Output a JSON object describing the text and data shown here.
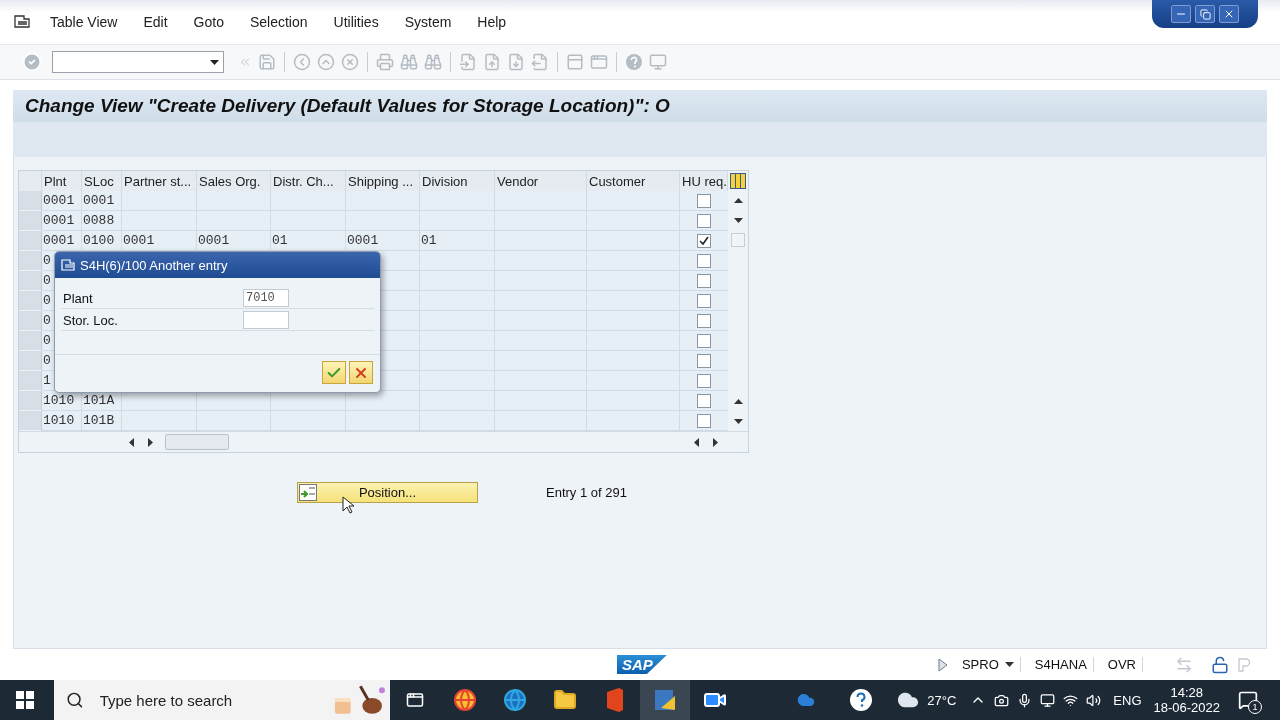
{
  "menu_bar": [
    "Table View",
    "Edit",
    "Goto",
    "Selection",
    "Utilities",
    "System",
    "Help"
  ],
  "title": "Change View \"Create Delivery (Default Values for Storage Location)\": O",
  "table": {
    "columns": [
      "Plnt",
      "SLoc",
      "Partner st...",
      "Sales Org.",
      "Distr. Ch...",
      "Shipping ...",
      "Division",
      "Vendor",
      "Customer",
      "HU req."
    ],
    "rows": [
      {
        "plnt": "0001",
        "sloc": "0001",
        "hu_req": false
      },
      {
        "plnt": "0001",
        "sloc": "0088",
        "hu_req": false
      },
      {
        "plnt": "0001",
        "sloc": "0100",
        "partner": "0001",
        "sales_org": "0001",
        "distr": "01",
        "shipping": "0001",
        "division": "01",
        "hu_req": true
      },
      {
        "plnt": "0",
        "hu_req": false
      },
      {
        "plnt": "0",
        "hu_req": false
      },
      {
        "plnt": "0",
        "hu_req": false
      },
      {
        "plnt": "0",
        "hu_req": false
      },
      {
        "plnt": "0",
        "hu_req": false
      },
      {
        "plnt": "0",
        "hu_req": false
      },
      {
        "plnt": "1",
        "hu_req": false
      },
      {
        "plnt": "1010",
        "sloc": "101A",
        "hu_req": false
      },
      {
        "plnt": "1010",
        "sloc": "101B",
        "hu_req": false
      }
    ]
  },
  "dialog": {
    "title": "S4H(6)/100 Another entry",
    "fields": [
      {
        "label": "Plant",
        "value": "7010"
      },
      {
        "label": "Stor. Loc."
      }
    ]
  },
  "position_button": "Position...",
  "entry_info": "Entry 1 of 291",
  "status_bar": {
    "logo": "SAP",
    "transaction": "SPRO",
    "system": "S4HANA",
    "mode": "OVR"
  },
  "taskbar": {
    "search_placeholder": "Type here to search",
    "temperature": "27°C",
    "language": "ENG",
    "time": "14:28",
    "date": "18-06-2022",
    "notification_count": "1"
  }
}
